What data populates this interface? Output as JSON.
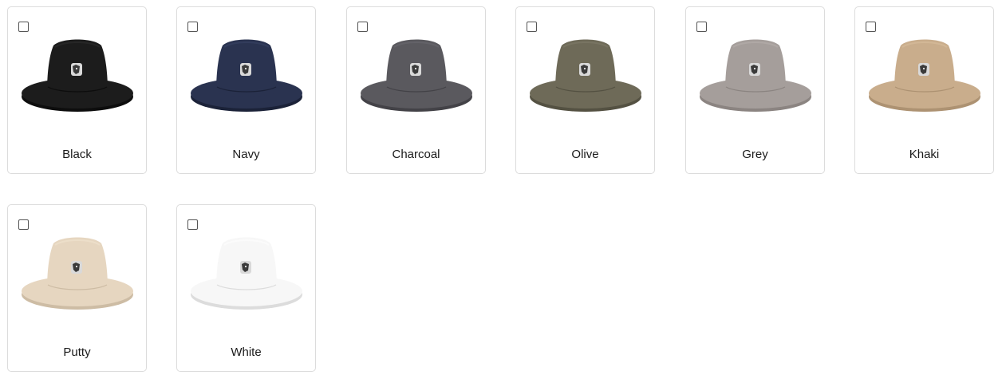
{
  "swatches": [
    {
      "label": "Black",
      "checked": false,
      "color": "#1c1c1c",
      "shade": "#0d0d0d",
      "band": "#262626"
    },
    {
      "label": "Navy",
      "checked": false,
      "color": "#2a3350",
      "shade": "#1b2238",
      "band": "#323c5c"
    },
    {
      "label": "Charcoal",
      "checked": false,
      "color": "#5a595e",
      "shade": "#434247",
      "band": "#636268"
    },
    {
      "label": "Olive",
      "checked": false,
      "color": "#6e6a58",
      "shade": "#545142",
      "band": "#787462"
    },
    {
      "label": "Grey",
      "checked": false,
      "color": "#a59e9b",
      "shade": "#8b8481",
      "band": "#afa8a5"
    },
    {
      "label": "Khaki",
      "checked": false,
      "color": "#c9ad8c",
      "shade": "#ad9272",
      "band": "#d2b796"
    },
    {
      "label": "Putty",
      "checked": false,
      "color": "#e6d6c0",
      "shade": "#cdbca4",
      "band": "#ecdec9"
    },
    {
      "label": "White",
      "checked": false,
      "color": "#f7f7f7",
      "shade": "#dcdcdc",
      "band": "#fbfbfb"
    }
  ]
}
